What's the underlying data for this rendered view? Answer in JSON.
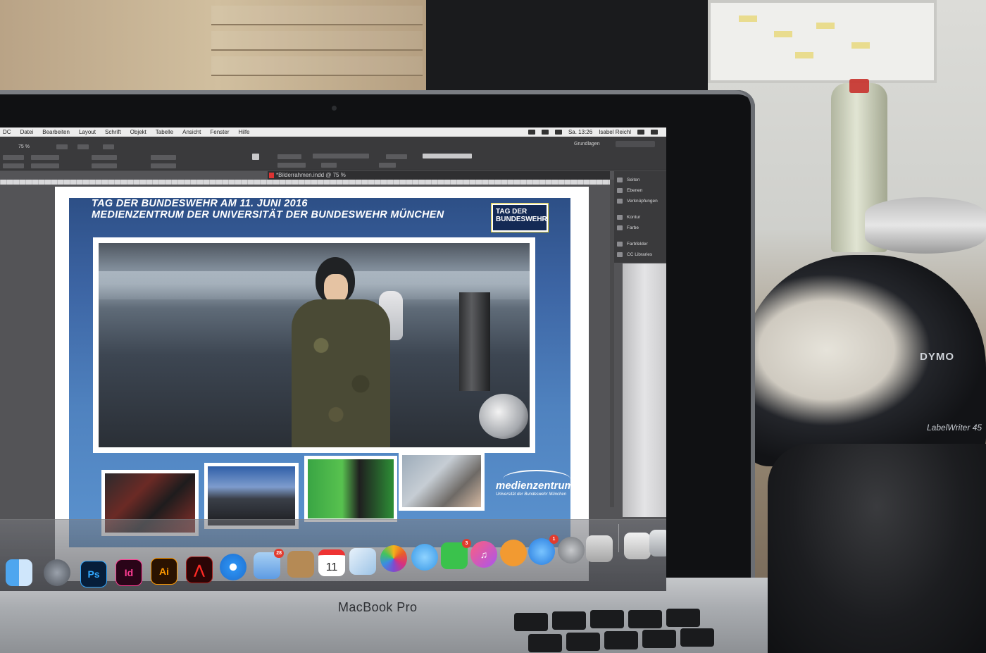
{
  "menubar": {
    "items": [
      "DC",
      "Datei",
      "Bearbeiten",
      "Layout",
      "Schrift",
      "Objekt",
      "Tabelle",
      "Ansicht",
      "Fenster",
      "Hilfe"
    ],
    "clock": "Sa. 13:26",
    "user": "Isabel Reichl"
  },
  "control_panel": {
    "zoom": "75 %",
    "workspace": "Grundlagen"
  },
  "document": {
    "tab_title": "*Bilderrahmen.indd @ 75 %"
  },
  "panels": {
    "items": [
      "Seiten",
      "Ebenen",
      "Verknüpfungen",
      "Kontur",
      "Farbe",
      "Farbfelder",
      "CC Libraries"
    ]
  },
  "layout_page": {
    "headline_1": "TAG DER BUNDESWEHR AM 11. JUNI 2016",
    "headline_2": "MEDIENZENTRUM DER UNIVERSITÄT DER BUNDESWEHR MÜNCHEN",
    "tag_logo_line1": "TAG DER",
    "tag_logo_line2": "BUNDESWEHR",
    "mz_logo_name": "medienzentrum",
    "mz_logo_sub": "Universität der Bundeswehr München"
  },
  "dock": {
    "calendar_day": "11",
    "badges": {
      "mail": "28",
      "facetime": "3",
      "appstore": "1"
    },
    "icons": [
      "finder-icon",
      "launchpad-icon",
      "photoshop-icon",
      "indesign-icon",
      "illustrator-icon",
      "acrobat-icon",
      "safari-icon",
      "mail-icon",
      "contacts-icon",
      "calendar-icon",
      "preview-icon",
      "photos-icon",
      "messages-icon",
      "facetime-icon",
      "itunes-icon",
      "ibooks-icon",
      "appstore-icon",
      "system-preferences-icon",
      "printer-icon",
      "documents-icon",
      "trash-icon"
    ],
    "app_labels": {
      "photoshop": "Ps",
      "indesign": "Id",
      "illustrator": "Ai"
    }
  },
  "laptop": {
    "brand": "MacBook Pro"
  },
  "printer": {
    "brand": "DYMO",
    "model": "LabelWriter 45"
  }
}
